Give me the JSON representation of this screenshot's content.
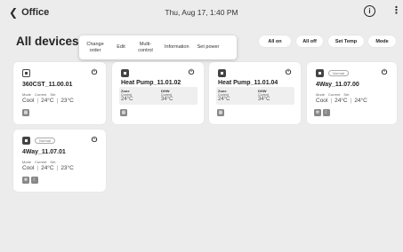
{
  "header": {
    "back_label": "Office",
    "back_icon": "chevron-left-icon",
    "datetime": "Thu, Aug 17, 1:40 PM",
    "info_glyph": "i",
    "more_glyph": "⋮"
  },
  "toolbar": {
    "title": "All devices",
    "title_caret": "▾",
    "context_menu": [
      "Change order",
      "Edit",
      "Multi-control",
      "Information",
      "Set power"
    ],
    "actions": [
      "All on",
      "All off",
      "Set Temp",
      "Mode"
    ]
  },
  "devices": [
    {
      "name": "360CST_11.00.01",
      "labels": [
        "Mode",
        "Current",
        "Set"
      ],
      "mode": "Cool",
      "current": "24°C",
      "set": "23°C",
      "badge": ""
    },
    {
      "name": "Heat Pump_11.01.02",
      "zone_label": "Zone",
      "zone_sub": "Current",
      "zone_value": "24°C",
      "dhw_label": "DHW",
      "dhw_sub": "Current",
      "dhw_value": "34°C"
    },
    {
      "name": "Heat Pump_11.01.04",
      "zone_label": "Zone",
      "zone_sub": "Current",
      "zone_value": "24°C",
      "dhw_label": "DHW",
      "dhw_sub": "Current",
      "dhw_value": "34°C"
    },
    {
      "name": "4Way_11.07.00",
      "labels": [
        "Mode",
        "Current",
        "Set"
      ],
      "mode": "Cool",
      "current": "24°C",
      "set": "24°C",
      "badge": "Normal"
    },
    {
      "name": "4Way_11.07.01",
      "labels": [
        "Mode",
        "Current",
        "Set"
      ],
      "mode": "Cool",
      "current": "24°C",
      "set": "23°C",
      "badge": "Normal"
    }
  ],
  "power_glyph": "⏻",
  "sep": "|"
}
